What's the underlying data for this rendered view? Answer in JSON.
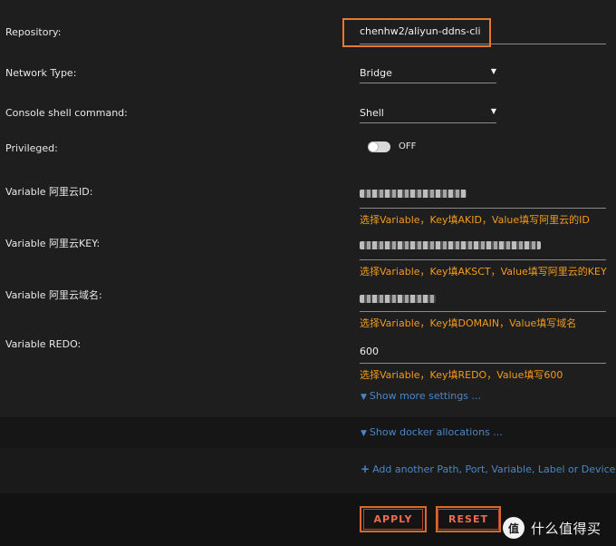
{
  "labels": {
    "repository": "Repository:",
    "network_type": "Network Type:",
    "console_shell": "Console shell command:",
    "privileged": "Privileged:",
    "var_id": "Variable 阿里云ID:",
    "var_key": "Variable 阿里云KEY:",
    "var_domain": "Variable 阿里云域名:",
    "var_redo": "Variable REDO:"
  },
  "fields": {
    "repository": "chenhw2/aliyun-ddns-cli",
    "network_type": "Bridge",
    "console_shell": "Shell",
    "privileged_state": "OFF",
    "redo_value": "600"
  },
  "hints": {
    "id": "选择Variable，Key填AKID，Value填写阿里云的ID",
    "key": "选择Variable，Key填AKSCT，Value填写阿里云的KEY",
    "domain": "选择Variable，Key填DOMAIN，Value填写域名",
    "redo": "选择Variable，Key填REDO，Value填写600"
  },
  "links": {
    "more_settings": "Show more settings ...",
    "docker_allocations": "Show docker allocations ...",
    "add_another": "Add another Path, Port, Variable, Label or Device"
  },
  "buttons": {
    "apply": "APPLY",
    "reset": "RESET"
  },
  "watermark": {
    "logo": "值",
    "text": "什么值得买"
  },
  "colors": {
    "hint": "#f39a1e",
    "link": "#4a86c8",
    "highlight_border": "#e8782c",
    "button_text": "#f06a4e"
  },
  "icons": {
    "select_caret": "triangle-down",
    "show_more": "chevron-down",
    "show_docker": "chevron-down",
    "add": "plus"
  }
}
